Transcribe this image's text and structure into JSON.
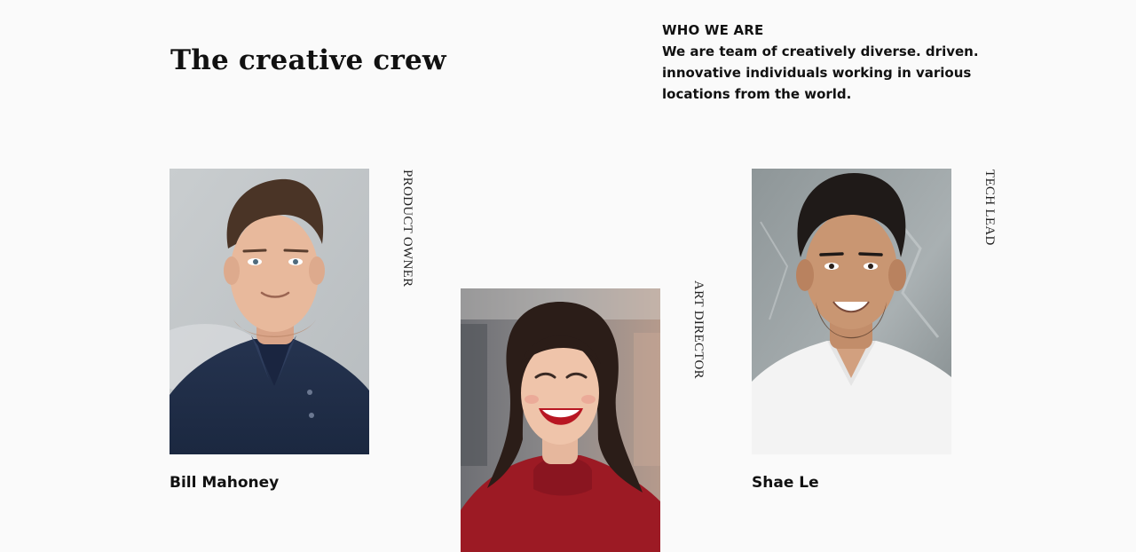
{
  "section": {
    "title": "The creative crew",
    "intro_heading": "WHO WE ARE",
    "intro_text": "We are team of creatively diverse. driven. innovative individuals working in various locations from the world."
  },
  "team": [
    {
      "name": "Bill Mahoney",
      "role": "PRODUCT OWNER",
      "photo_icon": "portrait-man-navy-polo"
    },
    {
      "name": "",
      "role": "ART DIRECTOR",
      "photo_icon": "portrait-woman-red-sweater"
    },
    {
      "name": "Shae Le",
      "role": "TECH LEAD",
      "photo_icon": "portrait-man-white-tshirt"
    }
  ],
  "colors": {
    "background": "#fafafa",
    "text": "#111111"
  }
}
